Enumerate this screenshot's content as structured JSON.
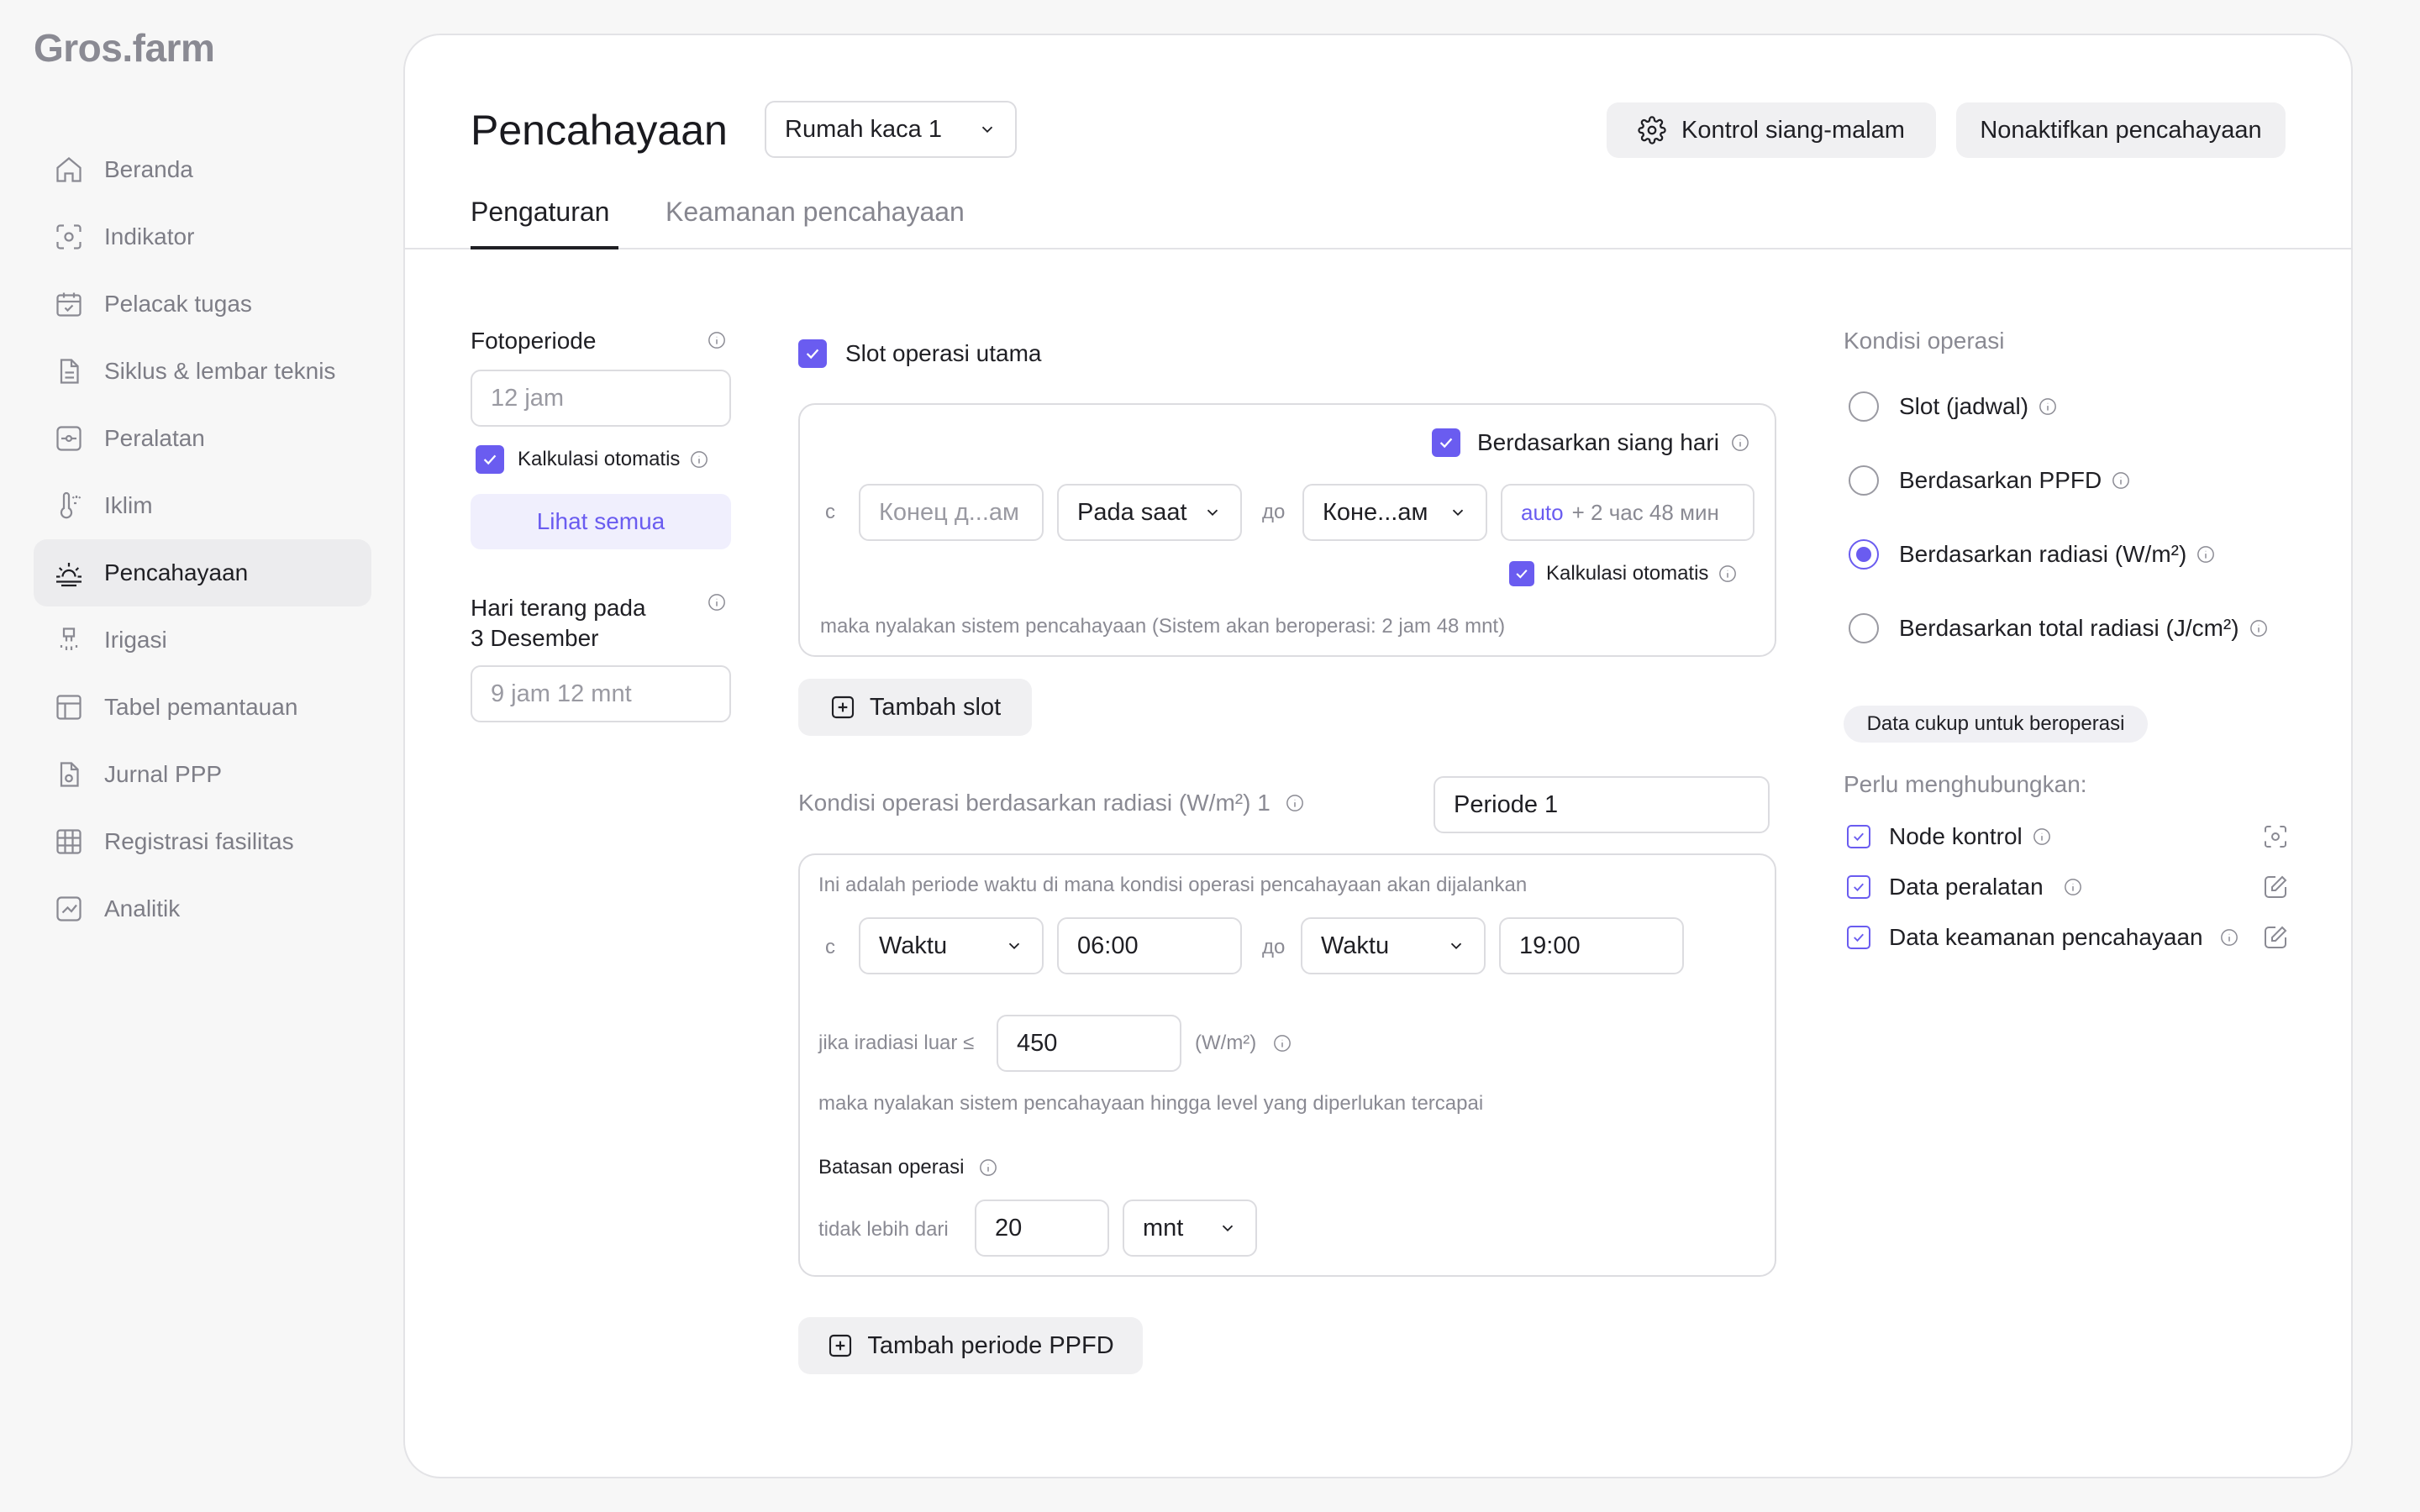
{
  "app": {
    "logo": "Gros.farm"
  },
  "sidebar": {
    "items": [
      {
        "label": "Beranda",
        "icon": "home-icon"
      },
      {
        "label": "Indikator",
        "icon": "sensor-icon"
      },
      {
        "label": "Pelacak tugas",
        "icon": "calendar-check-icon"
      },
      {
        "label": "Siklus & lembar teknis",
        "icon": "document-icon"
      },
      {
        "label": "Peralatan",
        "icon": "equipment-icon"
      },
      {
        "label": "Iklim",
        "icon": "thermometer-icon"
      },
      {
        "label": "Pencahayaan",
        "icon": "sunrise-icon",
        "active": true
      },
      {
        "label": "Irigasi",
        "icon": "irrigation-icon"
      },
      {
        "label": "Tabel pemantauan",
        "icon": "table-icon"
      },
      {
        "label": "Jurnal PPP",
        "icon": "journal-icon"
      },
      {
        "label": "Registrasi fasilitas",
        "icon": "grid-icon"
      },
      {
        "label": "Analitik",
        "icon": "chart-icon"
      }
    ]
  },
  "header": {
    "title": "Pencahayaan",
    "greenhouse_select": "Rumah kaca 1",
    "day_night_button": "Kontrol siang-malam",
    "disable_button": "Nonaktifkan pencahayaan"
  },
  "tabs": [
    {
      "label": "Pengaturan",
      "active": true
    },
    {
      "label": "Keamanan pencahayaan"
    }
  ],
  "left": {
    "photoperiod_label": "Fotoperiode",
    "photoperiod_placeholder": "12 jam",
    "auto_calc_label": "Kalkulasi otomatis",
    "view_all_button": "Lihat semua",
    "daylight_label_1": "Hari terang pada",
    "daylight_label_2": "3 Desember",
    "daylight_value": "9 jam 12 mnt"
  },
  "slot": {
    "main_slot_label": "Slot operasi utama",
    "based_on_daylight": "Berdasarkan siang hari",
    "from_prefix": "с",
    "from_placeholder": "Конец д...ам",
    "mode_select": "Pada saat",
    "to_prefix": "до",
    "to_select": "Коне...ам",
    "auto_tag": "auto",
    "auto_offset": "+ 2 час 48 мин",
    "auto_calc_label": "Kalkulasi otomatis",
    "note": "maka nyalakan sistem pencahayaan (Sistem akan beroperasi: 2 jam 48 mnt)",
    "add_slot_button": "Tambah slot"
  },
  "radiation": {
    "heading": "Kondisi operasi berdasarkan radiasi (W/m²) 1",
    "period_value": "Periode 1",
    "description": "Ini adalah periode waktu di mana kondisi operasi pencahayaan akan dijalankan",
    "from_prefix": "с",
    "from_type": "Waktu",
    "from_time": "06:00",
    "to_prefix": "до",
    "to_type": "Waktu",
    "to_time": "19:00",
    "irradiance_label": "jika iradiasi luar ≤",
    "irradiance_value": "450",
    "irradiance_unit": "(W/m²)",
    "action_note": "maka nyalakan sistem pencahayaan hingga level yang diperlukan tercapai",
    "limit_label": "Batasan operasi",
    "limit_prefix": "tidak lebih dari",
    "limit_value": "20",
    "limit_unit": "mnt",
    "add_period_button": "Tambah periode PPFD"
  },
  "conditions": {
    "heading": "Kondisi operasi",
    "options": [
      {
        "label": "Slot (jadwal)",
        "selected": false
      },
      {
        "label": "Berdasarkan PPFD",
        "selected": false
      },
      {
        "label": "Berdasarkan radiasi (W/m²)",
        "selected": true
      },
      {
        "label": "Berdasarkan total radiasi (J/cm²)",
        "selected": false
      }
    ],
    "status_badge": "Data cukup untuk beroperasi",
    "connect_label": "Perlu menghubungkan:",
    "connections": [
      {
        "label": "Node kontrol",
        "icon": "sensor-icon"
      },
      {
        "label": "Data peralatan",
        "icon": "edit-icon"
      },
      {
        "label": "Data keamanan pencahayaan",
        "icon": "edit-icon"
      }
    ]
  },
  "colors": {
    "accent": "#6a5cf0",
    "muted": "#8a8a93",
    "border": "#dcdce0"
  }
}
